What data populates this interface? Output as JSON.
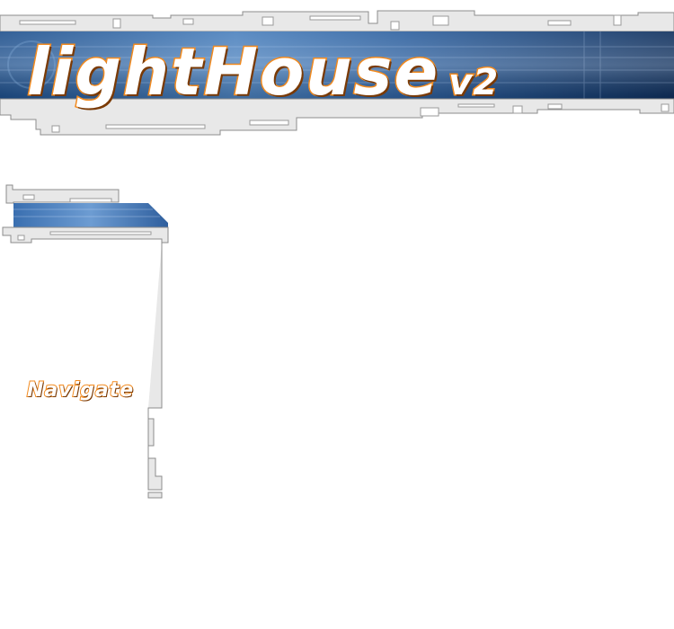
{
  "header": {
    "logo_main": "lightHouse",
    "logo_version": "v2",
    "colors": {
      "accent": "#f28a1e",
      "banner_dark": "#0d2e5c",
      "banner_light": "#5d8fc4",
      "frame": "#e6e6e6",
      "frame_border": "#8c8c8c"
    }
  },
  "nav": {
    "title": "Navigate"
  }
}
